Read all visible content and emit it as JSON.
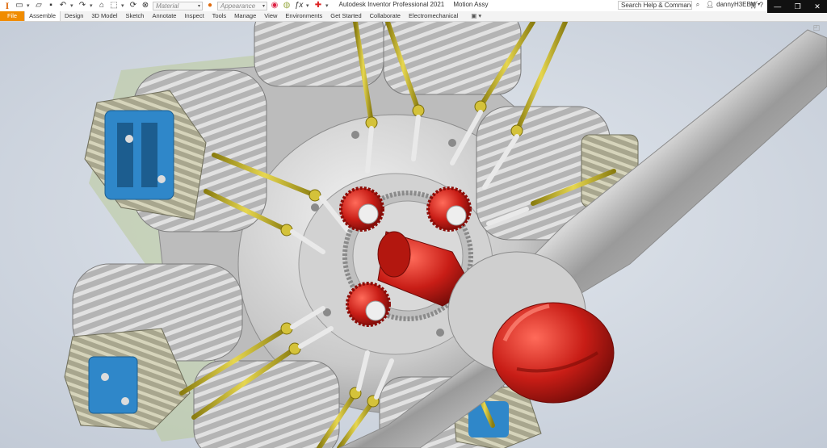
{
  "app": {
    "title": "Autodesk Inventor Professional 2021",
    "document": "Motion Assy"
  },
  "quick_access": {
    "material_placeholder": "Material",
    "appearance_placeholder": "Appearance"
  },
  "search": {
    "placeholder": "Search Help & Commands..."
  },
  "user": {
    "name": "dannyH3EBV"
  },
  "tabs": [
    {
      "label": "File"
    },
    {
      "label": "Assemble"
    },
    {
      "label": "Design"
    },
    {
      "label": "3D Model"
    },
    {
      "label": "Sketch"
    },
    {
      "label": "Annotate"
    },
    {
      "label": "Inspect"
    },
    {
      "label": "Tools"
    },
    {
      "label": "Manage"
    },
    {
      "label": "View"
    },
    {
      "label": "Environments"
    },
    {
      "label": "Get Started"
    },
    {
      "label": "Collaborate"
    },
    {
      "label": "Electromechanical"
    }
  ],
  "colors": {
    "file_tab": "#f08c00",
    "viewport_bg": "#cfd6e0",
    "gear_red": "#c81d16",
    "rod_yellow": "#c7b52a",
    "valve_blue": "#2f87c9",
    "casting_gray": "#bdbdbd",
    "propeller_silver": "#d7d7d7"
  }
}
